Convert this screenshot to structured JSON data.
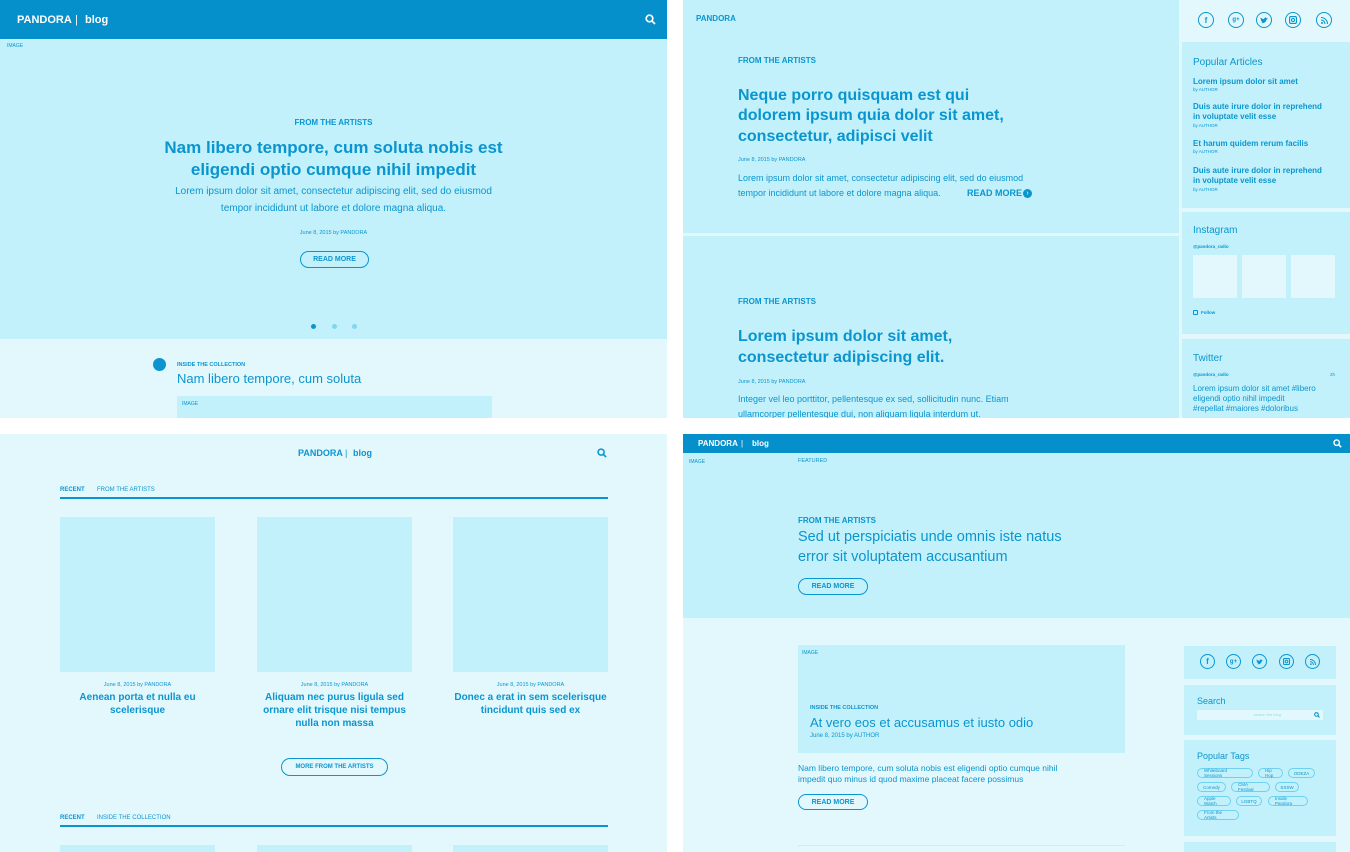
{
  "p1": {
    "brand": "PANDORA",
    "sep": "|",
    "blog": "blog",
    "image_label": "IMAGE",
    "kicker": "FROM THE ARTISTS",
    "title_l1": "Nam libero tempore, cum soluta nobis est",
    "title_l2": "eligendi optio cumque nihil impedit",
    "body_l1": "Lorem ipsum dolor sit amet, consectetur adipiscing elit, sed do eiusmod",
    "body_l2": "tempor incididunt ut labore et dolore magna aliqua.",
    "meta": "June 8, 2015 by PANDORA",
    "read_more": "READ MORE",
    "section_kicker": "INSIDE THE COLLECTION",
    "section_title": "Nam libero tempore, cum soluta",
    "section_image": "IMAGE"
  },
  "p2": {
    "brand": "PANDORA",
    "a1_kicker": "FROM THE ARTISTS",
    "a1_title_l1": "Neque porro quisquam est qui",
    "a1_title_l2": "dolorem ipsum quia dolor sit amet,",
    "a1_title_l3": "consectetur, adipisci velit",
    "a1_meta": "June 8, 2015 by PANDORA",
    "a1_body_l1": "Lorem ipsum dolor sit amet, consectetur adipiscing elit, sed do eiusmod",
    "a1_body_l2": "tempor incididunt ut labore et dolore magna aliqua.",
    "a1_read_more": "READ MORE",
    "a2_kicker": "FROM THE ARTISTS",
    "a2_title_l1": "Lorem ipsum dolor sit amet,",
    "a2_title_l2": "consectetur adipiscing elit.",
    "a2_meta": "June 8, 2015 by PANDORA",
    "a2_body_l1": "Integer vel leo porttitor, pellentesque ex sed, sollicitudin nunc. Etiam",
    "a2_body_l2": "ullamcorper pellentesque dui, non aliquam ligula interdum ut.",
    "popular_title": "Popular Articles",
    "popular": [
      {
        "l1": "Lorem ipsum dolor sit amet",
        "l2": "",
        "by": "by AUTHOR"
      },
      {
        "l1": "Duis aute irure dolor in reprehend",
        "l2": "in voluptate velit esse",
        "by": "by AUTHOR"
      },
      {
        "l1": "Et harum quidem rerum facilis",
        "l2": "",
        "by": "by AUTHOR"
      },
      {
        "l1": "Duis aute irure dolor in reprehend",
        "l2": "in voluptate velit esse",
        "by": "by AUTHOR"
      }
    ],
    "instagram_title": "Instagram",
    "instagram_handle": "@pandora_radio",
    "follow": "Follow",
    "twitter_title": "Twitter",
    "twitter_handle": "@pandora_radio",
    "twitter_time": "2h",
    "tweet_l1": "Lorem ipsum dolor sit amet #libero",
    "tweet_l2": "eligendi optio nihil impedit",
    "tweet_l3": "#repellat #maiores #doloribus"
  },
  "p3": {
    "brand": "PANDORA",
    "sep": "|",
    "blog": "blog",
    "tab_recent": "RECENT",
    "tab_artists": "FROM THE ARTISTS",
    "cards": [
      {
        "meta": "June 8, 2015 by PANDORA",
        "l1": "Aenean porta et nulla eu",
        "l2": "scelerisque",
        "l3": ""
      },
      {
        "meta": "June 8, 2015 by PANDORA",
        "l1": "Aliquam nec purus ligula sed",
        "l2": "ornare elit trisque nisi tempus",
        "l3": "nulla non massa"
      },
      {
        "meta": "June 8, 2015 by PANDORA",
        "l1": "Donec a erat in sem scelerisque",
        "l2": "tincidunt quis sed ex",
        "l3": ""
      }
    ],
    "more_button": "MORE FROM THE ARTISTS",
    "tab2_recent": "RECENT",
    "tab2_collection": "INSIDE THE COLLECTION"
  },
  "p4": {
    "brand": "PANDORA",
    "sep": "|",
    "blog": "blog",
    "image_label": "IMAGE",
    "featured_label": "FEATURED",
    "kicker": "FROM THE ARTISTS",
    "title_l1": "Sed ut perspiciatis unde omnis iste natus",
    "title_l2": "error sit voluptatem accusantium",
    "read_more": "READ MORE",
    "card_image": "IMAGE",
    "card_kicker": "INSIDE THE COLLECTION",
    "card_title": "At vero eos et accusamus et iusto odio",
    "card_meta": "June 8, 2015 by AUTHOR",
    "body_l1": "Nam libero tempore, cum soluta nobis est eligendi optio cumque nihil",
    "body_l2": "impedit quo minus id quod maxime placeat facere possimus",
    "read_more2": "READ MORE",
    "search_title": "Search",
    "search_placeholder": "search the blog",
    "tags_title": "Popular Tags",
    "tags": [
      "Whiteboard Sessions",
      "Hip Hop",
      "ODEZA",
      "Comedy",
      "CMA Festival",
      "SXSW",
      "Apple Watch",
      "LGBTQ",
      "Inside Pandora",
      "From the Artists"
    ]
  },
  "colors": {
    "accent": "#0b95cf",
    "light": "#c3f1fb",
    "pale": "#e3f8fd"
  },
  "social_icons": [
    "facebook-icon",
    "google-plus-icon",
    "twitter-icon",
    "instagram-icon",
    "rss-icon"
  ]
}
